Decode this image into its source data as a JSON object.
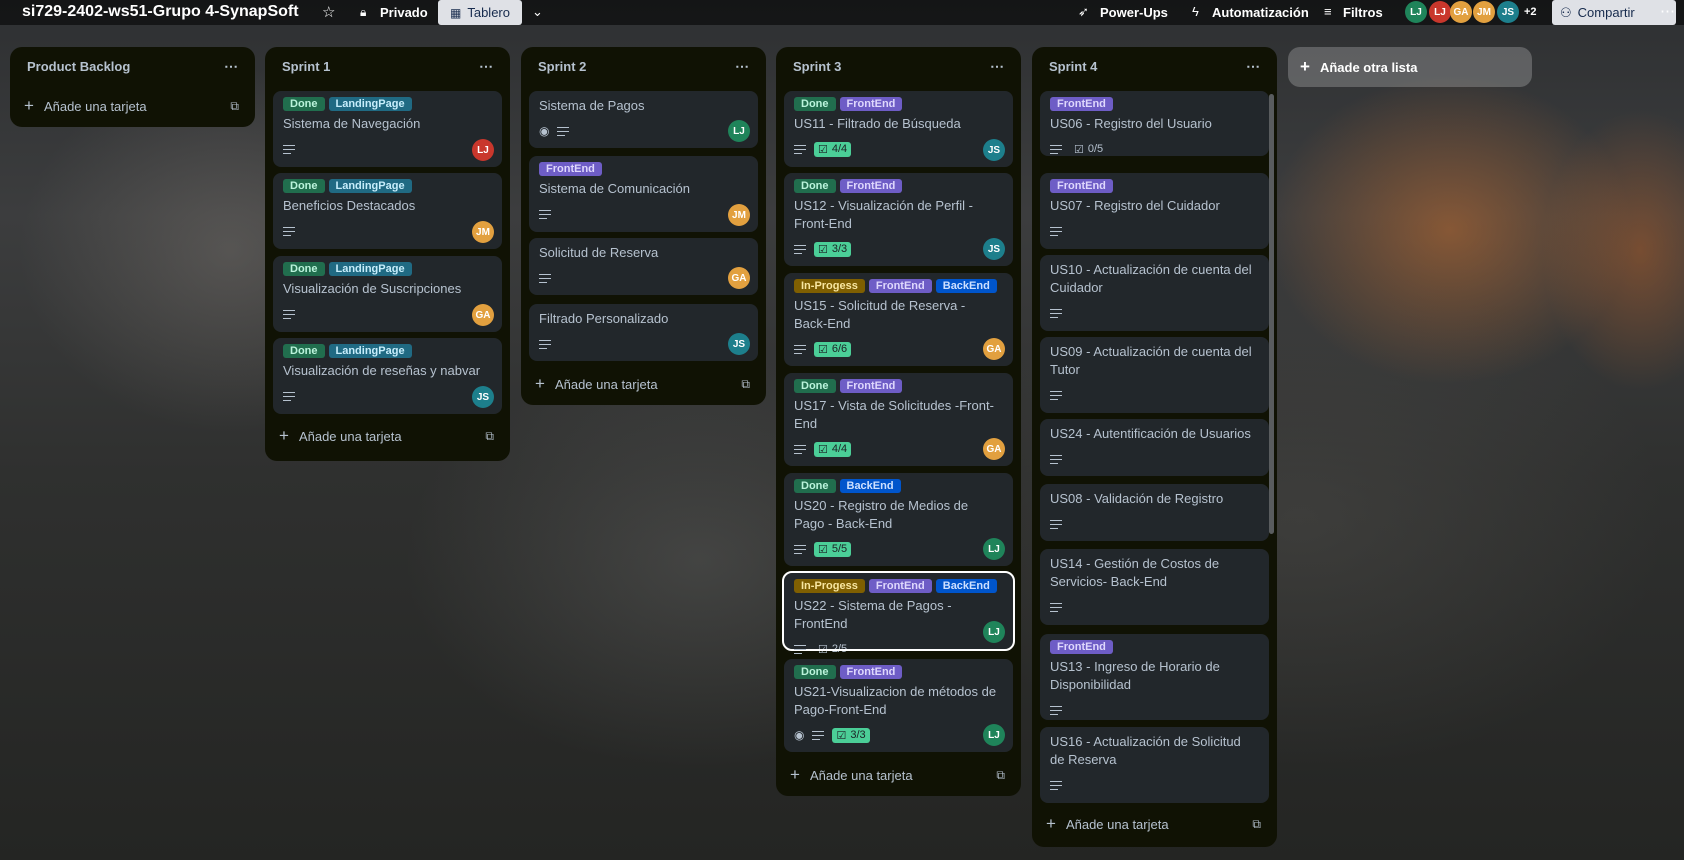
{
  "board": {
    "title": "si729-2402-ws51-Grupo 4-SynapSoft",
    "visibility": "Privado",
    "view": "Tablero"
  },
  "topbar": {
    "powerups": "Power-Ups",
    "automation": "Automatización",
    "filters": "Filtros",
    "more_members": "+2",
    "share": "Compartir"
  },
  "members": [
    {
      "initials": "LJ",
      "color": "#1f845a"
    },
    {
      "initials": "LJ",
      "color": "#c9372c"
    },
    {
      "initials": "GA",
      "color": "#e2a03f"
    },
    {
      "initials": "JM",
      "color": "#e2a03f"
    },
    {
      "initials": "JS",
      "color": "#1d7f8c"
    }
  ],
  "add_list": "Añade otra lista",
  "add_card": "Añade una tarjeta",
  "lists": [
    {
      "title": "Product Backlog",
      "cards": []
    },
    {
      "title": "Sprint 1",
      "cards": [
        {
          "labels": [
            "Done",
            "LandingPage"
          ],
          "title": "Sistema de Navegación",
          "avatar": "LJ"
        },
        {
          "labels": [
            "Done",
            "LandingPage"
          ],
          "title": "Beneficios Destacados",
          "avatar": "JM"
        },
        {
          "labels": [
            "Done",
            "LandingPage"
          ],
          "title": "Visualización de Suscripciones",
          "avatar": "GA"
        },
        {
          "labels": [
            "Done",
            "LandingPage"
          ],
          "title": "Visualización de reseñas y nabvar",
          "avatar": "JS"
        }
      ]
    },
    {
      "title": "Sprint 2",
      "cards": [
        {
          "title": "Sistema de Pagos",
          "avatar": "LJ"
        },
        {
          "labels": [
            "FrontEnd"
          ],
          "title": "Sistema de Comunicación",
          "avatar": "JM"
        },
        {
          "title": "Solicitud de Reserva",
          "avatar": "GA"
        },
        {
          "title": "Filtrado Personalizado",
          "avatar": "JS"
        }
      ]
    },
    {
      "title": "Sprint 3",
      "cards": [
        {
          "labels": [
            "Done",
            "FrontEnd"
          ],
          "title": "US11 - Filtrado de Búsqueda",
          "checklist": "4/4",
          "avatar": "JS"
        },
        {
          "labels": [
            "Done",
            "FrontEnd"
          ],
          "title": "US12 - Visualización de Perfil - Front-End",
          "checklist": "3/3",
          "avatar": "JS"
        },
        {
          "labels": [
            "In-Progess",
            "FrontEnd",
            "BackEnd"
          ],
          "title": "US15 - Solicitud de Reserva - Back-End",
          "checklist": "6/6",
          "avatar": "GA"
        },
        {
          "labels": [
            "Done",
            "FrontEnd"
          ],
          "title": "US17 - Vista de Solicitudes -Front-End",
          "checklist": "4/4",
          "avatar": "GA"
        },
        {
          "labels": [
            "Done",
            "BackEnd"
          ],
          "title": "US20 - Registro de Medios de Pago - Back-End",
          "checklist": "5/5",
          "avatar": "LJ"
        },
        {
          "labels": [
            "In-Progess",
            "FrontEnd",
            "BackEnd"
          ],
          "title": "US22 - Sistema de Pagos - FrontEnd",
          "checklist": "2/5",
          "avatar": "LJ"
        },
        {
          "labels": [
            "Done",
            "FrontEnd"
          ],
          "title": "US21-Visualizacion de métodos de Pago-Front-End",
          "checklist": "3/3",
          "avatar": "LJ"
        }
      ]
    },
    {
      "title": "Sprint 4",
      "cards": [
        {
          "labels": [
            "FrontEnd"
          ],
          "title": "US06 - Registro del Usuario",
          "checklist": "0/5"
        },
        {
          "labels": [
            "FrontEnd"
          ],
          "title": "US07 - Registro del Cuidador"
        },
        {
          "title": "US10 - Actualización de cuenta del Cuidador"
        },
        {
          "title": "US09 - Actualización de cuenta del Tutor"
        },
        {
          "title": "US24 - Autentificación de Usuarios"
        },
        {
          "title": "US08 - Validación de Registro"
        },
        {
          "title": "US14 - Gestión de Costos de Servicios- Back-End"
        },
        {
          "labels": [
            "FrontEnd"
          ],
          "title": "US13 - Ingreso de Horario de Disponibilidad"
        },
        {
          "title": "US16 - Actualización de Solicitud de Reserva"
        }
      ]
    }
  ]
}
